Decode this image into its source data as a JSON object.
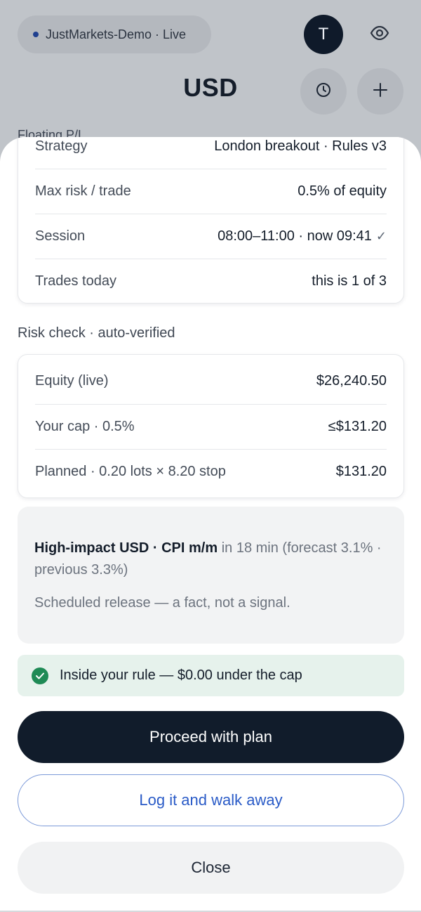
{
  "header": {
    "account_label": "JustMarkets-Demo · Live",
    "avatar_initial": "T",
    "currency": "USD",
    "floating_label": "Floating P/L"
  },
  "plan": {
    "rows": [
      {
        "label": "Strategy",
        "value": "London breakout · Rules v3"
      },
      {
        "label": "Max risk / trade",
        "value": "0.5% of equity"
      },
      {
        "label": "Session",
        "value": "08:00–11:00 · now 09:41",
        "check": "✓"
      },
      {
        "label": "Trades today",
        "value": "this is 1 of 3"
      }
    ]
  },
  "risk": {
    "section_label": "Risk check · auto-verified",
    "rows": [
      {
        "label": "Equity (live)",
        "value": "$26,240.50"
      },
      {
        "label": "Your cap · 0.5%",
        "value": "≤$131.20"
      },
      {
        "label": "Planned · 0.20 lots × 8.20 stop",
        "value": "$131.20"
      }
    ]
  },
  "event": {
    "title": "High-impact USD · CPI m/m",
    "detail": " in 18 min (forecast 3.1% · previous 3.3%)",
    "note": "Scheduled release — a fact, not a signal."
  },
  "status": {
    "message": "Inside your rule — $0.00 under the cap"
  },
  "actions": {
    "proceed_label": "Proceed with plan",
    "log_label": "Log it and walk away",
    "close_label": "Close"
  },
  "colors": {
    "primary": "#111c2b",
    "accent_blue": "#2a5bc7",
    "success": "#1e8a55",
    "success_bg": "#e6f2ec"
  }
}
